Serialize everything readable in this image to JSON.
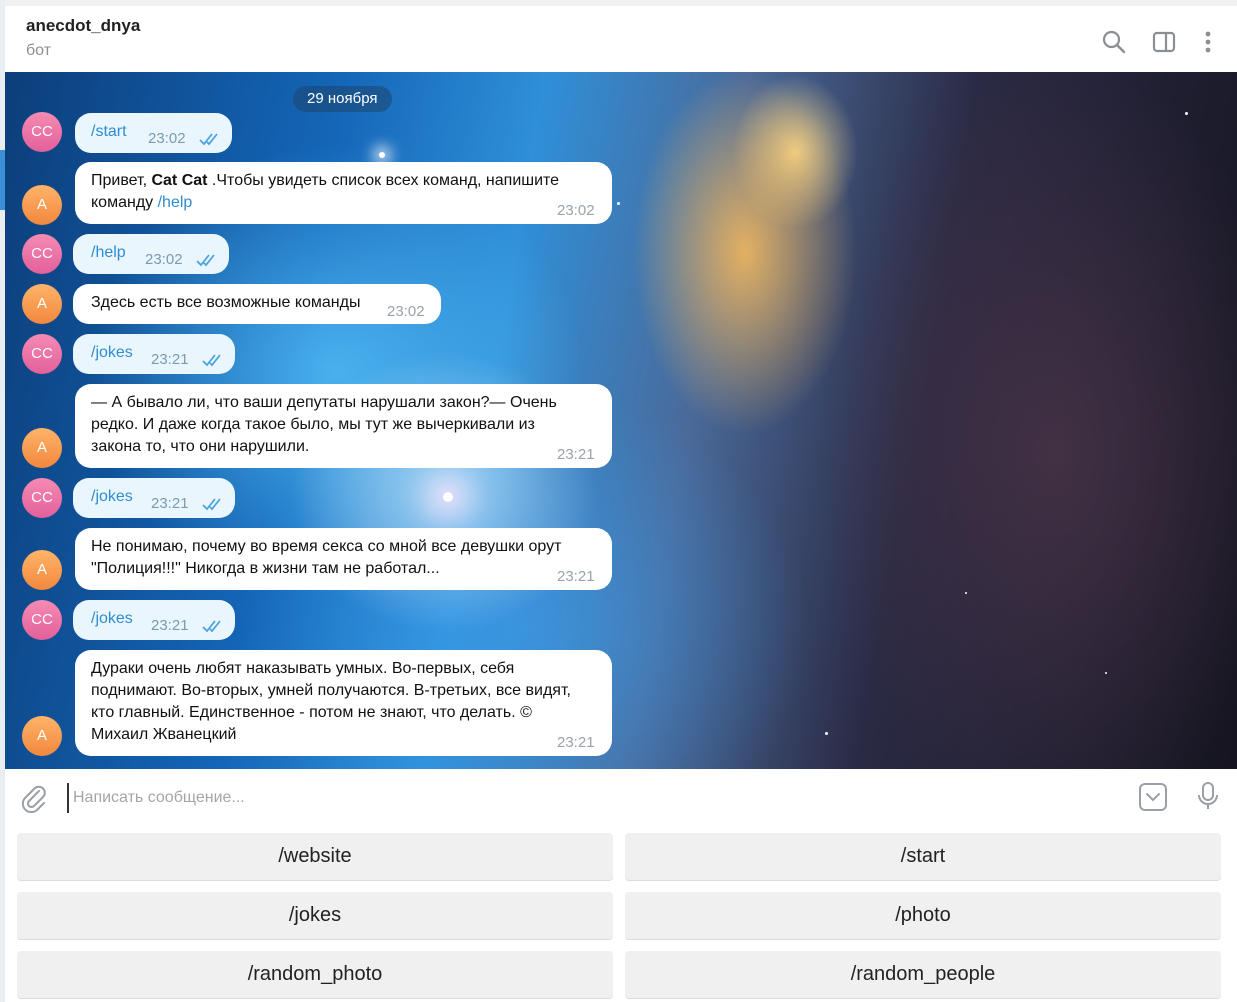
{
  "header": {
    "title": "anecdot_dnya",
    "subtitle": "бот",
    "icons": [
      "search-icon",
      "sidebar-toggle-icon",
      "more-vert-icon"
    ]
  },
  "chat": {
    "date": "29 ноября",
    "messages": [
      {
        "side": "out",
        "avatar": "CC",
        "text": "/start",
        "time": "23:02"
      },
      {
        "side": "in",
        "avatar": "A",
        "text_before": "Привет, ",
        "bold": "Cat Cat",
        "text_after": " .Чтобы увидеть список всех команд, напишите",
        "line2_before": "команду ",
        "line2_cmd": "/help",
        "time": "23:02"
      },
      {
        "side": "out",
        "avatar": "CC",
        "text": "/help",
        "time": "23:02"
      },
      {
        "side": "in",
        "avatar": "A",
        "text": "Здесь есть все возможные команды",
        "time": "23:02"
      },
      {
        "side": "out",
        "avatar": "CC",
        "text": "/jokes",
        "time": "23:21"
      },
      {
        "side": "in",
        "avatar": "A",
        "lines": [
          "— А бывало ли, что ваши депутаты нарушали закон?— Очень",
          "редко. И даже когда такое было, мы тут же вычеркивали из",
          "закона то, что они нарушили."
        ],
        "time": "23:21"
      },
      {
        "side": "out",
        "avatar": "CC",
        "text": "/jokes",
        "time": "23:21"
      },
      {
        "side": "in",
        "avatar": "A",
        "lines": [
          "Не понимаю, почему во время секса со мной все девушки орут",
          "\"Полиция!!!\" Никогда в жизни там не работал..."
        ],
        "time": "23:21"
      },
      {
        "side": "out",
        "avatar": "CC",
        "text": "/jokes",
        "time": "23:21"
      },
      {
        "side": "in",
        "avatar": "A",
        "lines": [
          "Дураки очень любят наказывать умных. Во-первых, себя",
          "поднимают. Во-вторых, умней получаются. В-третьих, все видят,",
          "кто главный. Единственное - потом не знают, что делать. ©",
          "Михаил Жванецкий"
        ],
        "time": "23:21"
      }
    ]
  },
  "input": {
    "placeholder": "Написать сообщение...",
    "icons": [
      "attach-icon",
      "keyboard-toggle-icon",
      "microphone-icon"
    ]
  },
  "keyboard": {
    "buttons": [
      "/website",
      "/start",
      "/jokes",
      "/photo",
      "/random_photo",
      "/random_people"
    ]
  },
  "colors": {
    "outgoing_bubble": "#eaf6fd",
    "command_link": "#2f8dd0",
    "avatar_cc": "#e2609a",
    "avatar_a": "#f2883e"
  }
}
